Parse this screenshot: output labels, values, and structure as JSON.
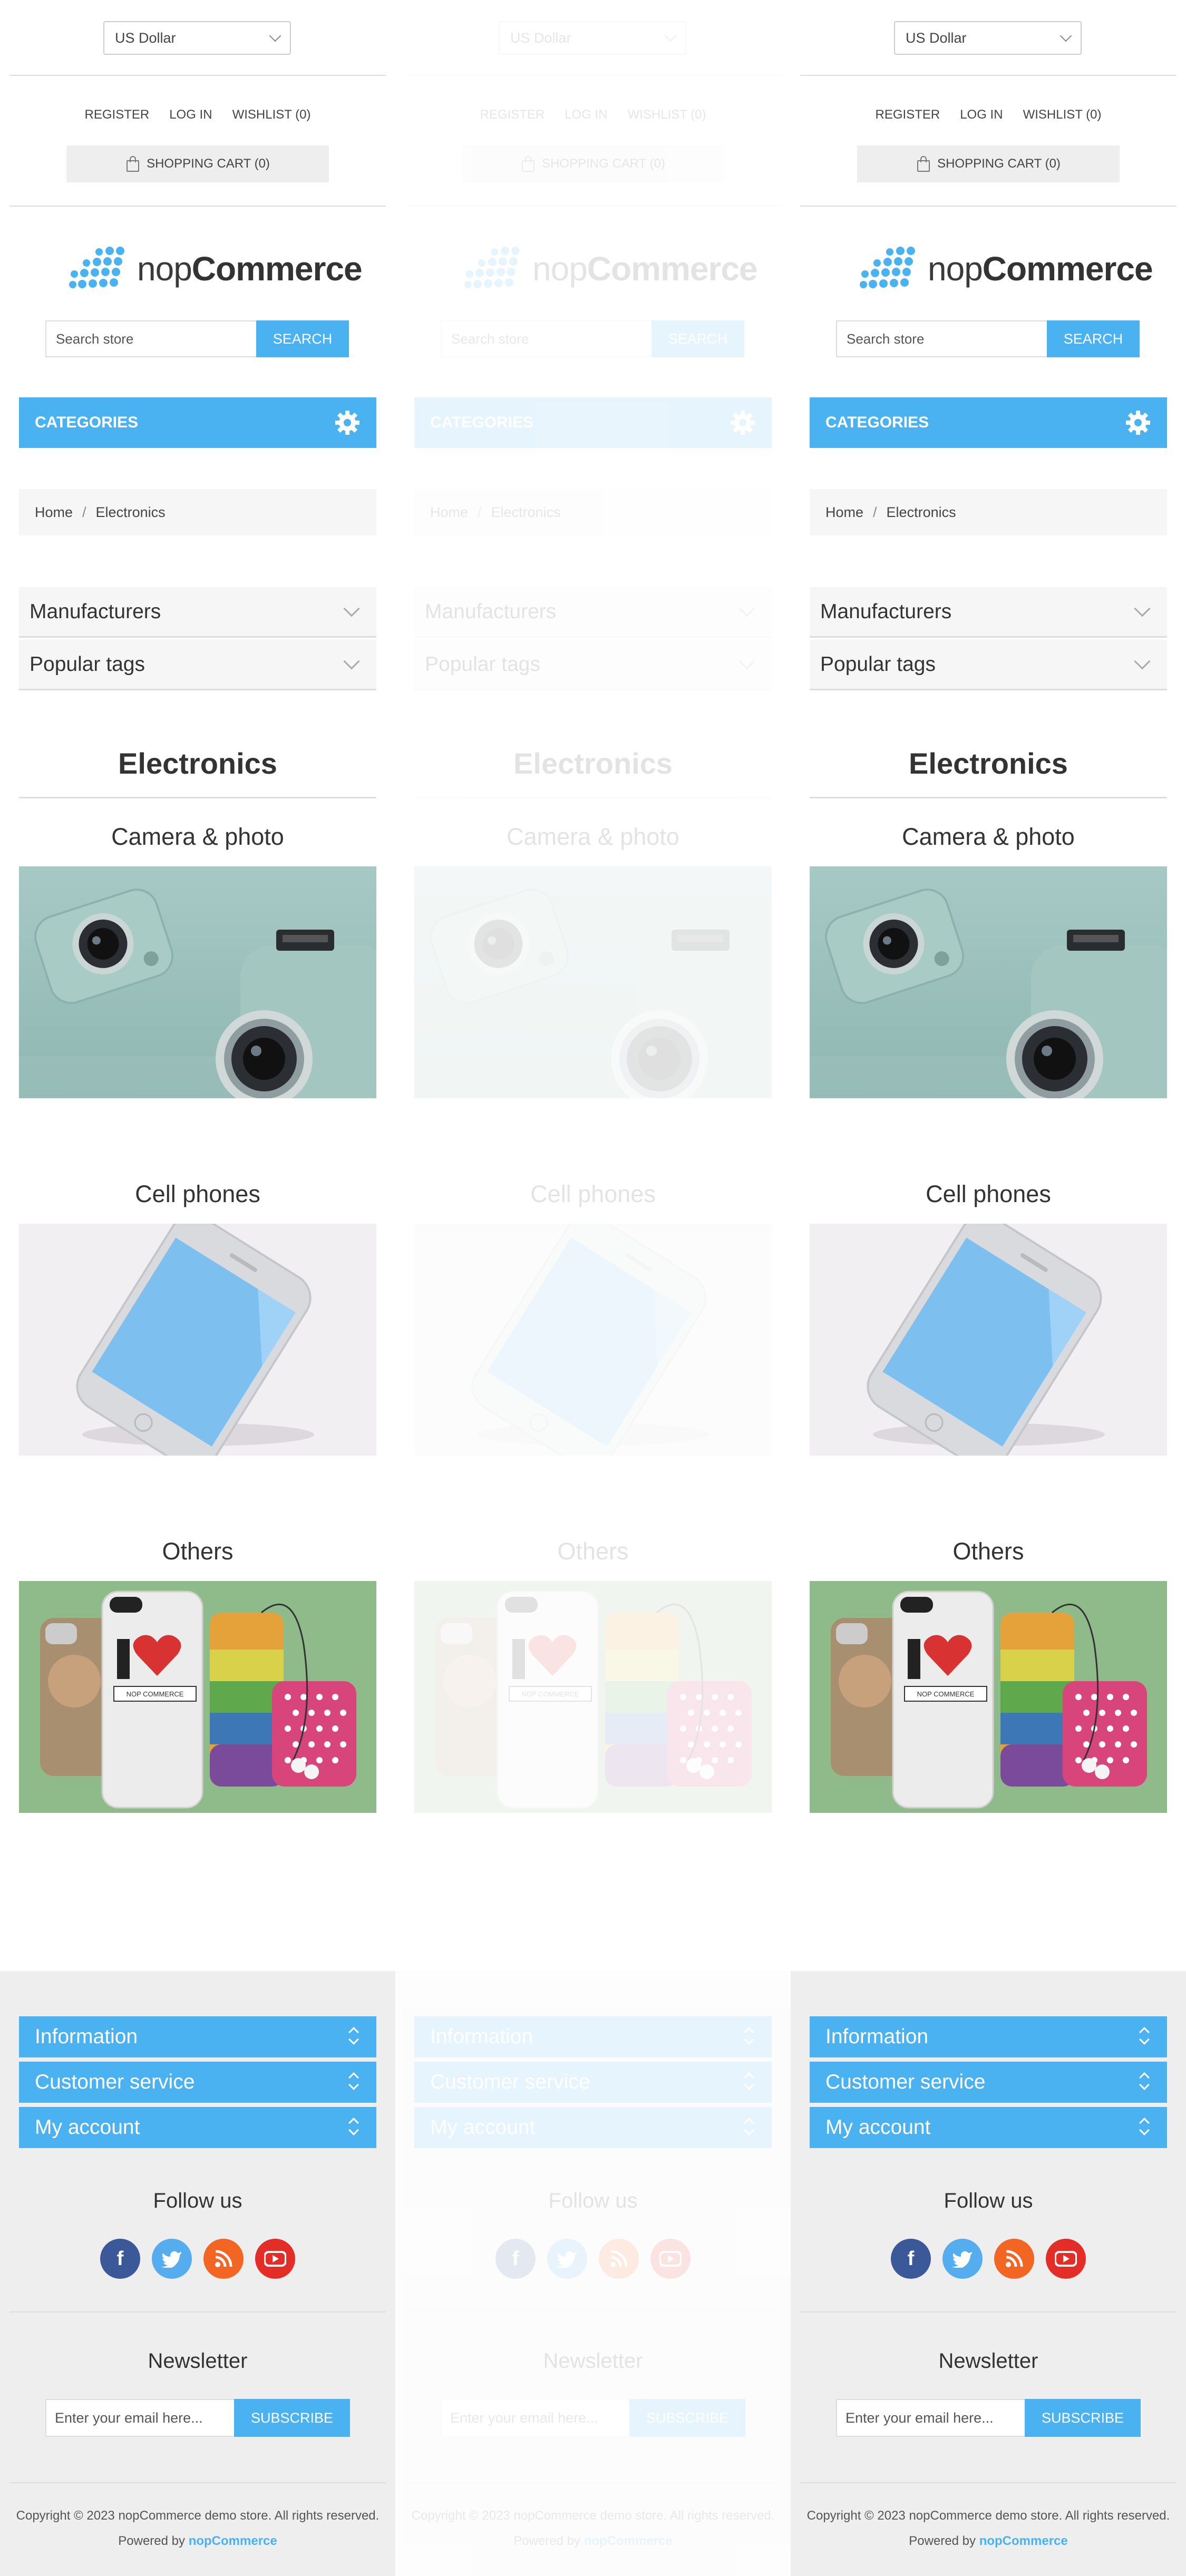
{
  "currency": {
    "selected": "US Dollar"
  },
  "header_links": {
    "register": "REGISTER",
    "login": "LOG IN",
    "wishlist": "WISHLIST (0)"
  },
  "cart": {
    "label": "SHOPPING CART (0)"
  },
  "logo": {
    "text_light": "nop",
    "text_bold": "Commerce"
  },
  "search": {
    "placeholder": "Search store",
    "button": "SEARCH"
  },
  "categories": {
    "label": "CATEGORIES"
  },
  "breadcrumb": {
    "home": "Home",
    "separator": "/",
    "current": "Electronics"
  },
  "side_blocks": {
    "manufacturers": "Manufacturers",
    "popular_tags": "Popular tags"
  },
  "page": {
    "title": "Electronics"
  },
  "subcategories": [
    {
      "title": "Camera & photo"
    },
    {
      "title": "Cell phones"
    },
    {
      "title": "Others"
    }
  ],
  "footer": {
    "accordions": [
      "Information",
      "Customer service",
      "My account"
    ],
    "follow_title": "Follow us",
    "socials": [
      "facebook-icon",
      "twitter-icon",
      "rss-icon",
      "youtube-icon"
    ],
    "newsletter_title": "Newsletter",
    "newsletter_placeholder": "Enter your email here...",
    "subscribe": "SUBSCRIBE",
    "copyright": "Copyright © 2023 nopCommerce demo store. All rights reserved.",
    "powered_prefix": "Powered by",
    "powered_brand": "nopCommerce"
  },
  "colors": {
    "accent": "#4ab2f1",
    "footer_bg": "#eeeeee",
    "facebook": "#3b5998",
    "twitter": "#55acee",
    "rss": "#f26522",
    "youtube": "#e52d27"
  },
  "columns": [
    {
      "state": "normal"
    },
    {
      "state": "faded"
    },
    {
      "state": "normal"
    }
  ]
}
